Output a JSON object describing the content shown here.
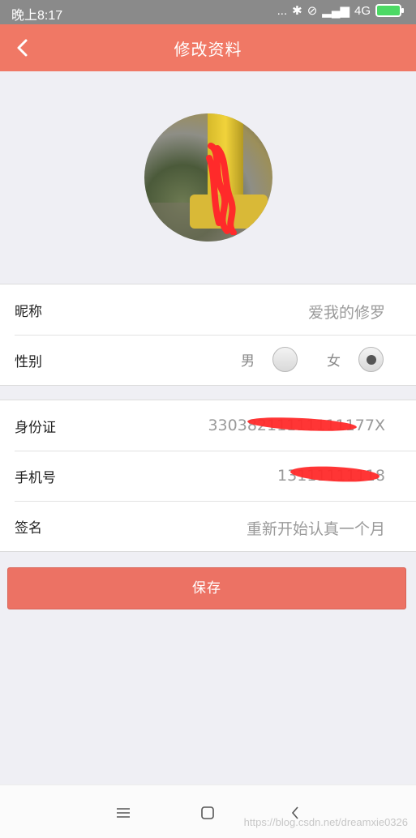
{
  "status_bar": {
    "time": "晚上8:17",
    "dots": "...",
    "network": "4G",
    "network_sub": "ıı"
  },
  "header": {
    "title": "修改资料",
    "back_icon": "chevron-left-icon"
  },
  "profile": {
    "nickname_label": "昵称",
    "nickname_value": "爱我的修罗",
    "gender_label": "性别",
    "gender_options": [
      "男",
      "女"
    ],
    "gender_selected": "女"
  },
  "details": {
    "id_label": "身份证",
    "id_value": "33038211111111177X",
    "phone_label": "手机号",
    "phone_value": "13111111118",
    "signature_label": "签名",
    "signature_value": "重新开始认真一个月"
  },
  "save_label": "保存",
  "nav": {
    "menu_icon": "menu-icon",
    "home_icon": "home-icon",
    "back_icon": "back-icon"
  },
  "watermark": "https://blog.csdn.net/dreamxie0326",
  "colors": {
    "header": "#f07865",
    "save_button": "#ec7264",
    "background": "#efeff4"
  }
}
